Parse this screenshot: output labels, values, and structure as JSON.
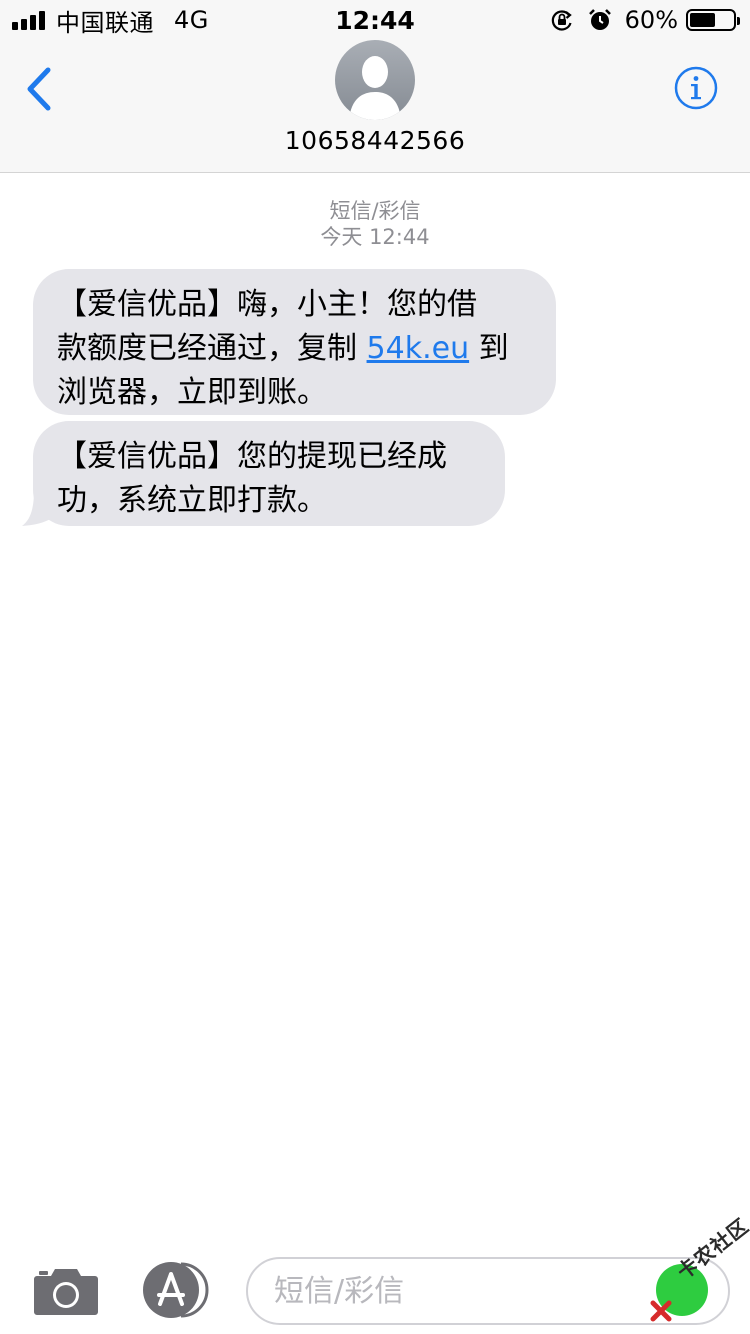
{
  "status_bar": {
    "carrier": "中国联通",
    "network": "4G",
    "time": "12:44",
    "battery_percent": "60%",
    "battery_level": 0.6
  },
  "header": {
    "contact": "10658442566"
  },
  "conversation": {
    "service": "短信/彩信",
    "timestamp": "今天 12:44",
    "messages": [
      {
        "lines": [
          "【爱信优品】嗨，小主！您的借",
          "款额度已经通过，复制 ",
          "54k.eu",
          " 到",
          "浏览器，立即到账。"
        ]
      },
      {
        "lines": [
          "【爱信优品】您的提现已经成",
          "功，系统立即打款。"
        ]
      }
    ]
  },
  "input_bar": {
    "placeholder": "短信/彩信"
  },
  "watermark": {
    "text": "卡农社区"
  },
  "colors": {
    "accent": "#1f7aec",
    "bubble": "#e5e5ea",
    "header_bg": "#f7f7f7",
    "meta_text": "#8e8e93",
    "icon_gray": "#6d6d72"
  },
  "icons": [
    "back-chevron-icon",
    "avatar-icon",
    "info-icon",
    "camera-icon",
    "app-store-icon",
    "orientation-lock-icon",
    "alarm-icon",
    "battery-icon",
    "signal-icon"
  ]
}
